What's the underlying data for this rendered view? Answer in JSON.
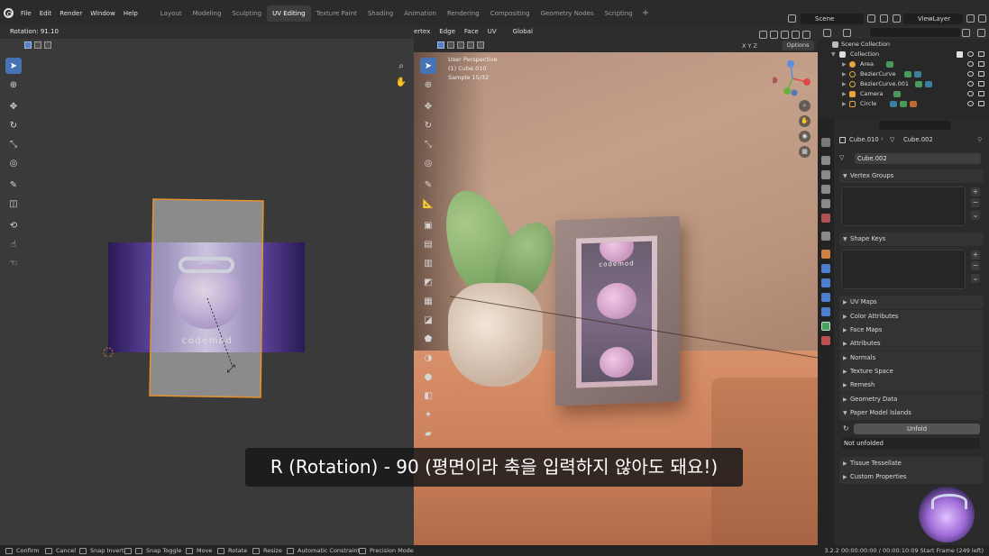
{
  "topbar": {
    "menus": [
      "File",
      "Edit",
      "Render",
      "Window",
      "Help"
    ],
    "workspaces": [
      "Layout",
      "Modeling",
      "Sculpting",
      "UV Editing",
      "Texture Paint",
      "Shading",
      "Animation",
      "Rendering",
      "Compositing",
      "Geometry Nodes",
      "Scripting"
    ],
    "active_workspace": "UV Editing",
    "add_workspace": "+",
    "scene": "Scene",
    "view_layer": "ViewLayer"
  },
  "uv_editor": {
    "rotation_readout": "Rotation: 91.10",
    "logo_text": "codemod"
  },
  "viewport": {
    "menus": [
      "ertex",
      "Edge",
      "Face",
      "UV"
    ],
    "orientation": "Global",
    "options_label": "Options",
    "axes_label": "X Y Z",
    "overlay": {
      "perspective": "User Perspective",
      "object": "(1) Cube.010",
      "samples": "Sample 15/32"
    },
    "frame_logo": "codemod"
  },
  "outliner": {
    "scene_collection": "Scene Collection",
    "collection": "Collection",
    "items": [
      {
        "name": "Area",
        "color": "#e8a33d"
      },
      {
        "name": "BezierCurve",
        "color": "#e8a33d"
      },
      {
        "name": "BezierCurve.001",
        "color": "#e8a33d"
      },
      {
        "name": "Camera",
        "color": "#e8a33d"
      },
      {
        "name": "Circle",
        "color": "#e8a33d"
      }
    ]
  },
  "properties": {
    "breadcrumb_object": "Cube.010",
    "breadcrumb_mesh": "Cube.002",
    "mesh_name": "Cube.002",
    "panels": {
      "vertex_groups": "Vertex Groups",
      "shape_keys": "Shape Keys",
      "uv_maps": "UV Maps",
      "color_attributes": "Color Attributes",
      "face_maps": "Face Maps",
      "attributes": "Attributes",
      "normals": "Normals",
      "texture_space": "Texture Space",
      "remesh": "Remesh",
      "geometry_data": "Geometry Data",
      "paper_model_islands": "Paper Model Islands",
      "tissue_tessellate": "Tissue Tessellate",
      "custom_properties": "Custom Properties"
    },
    "unfold_button": "Unfold",
    "not_unfolded": "Not unfolded"
  },
  "subtitle": "R (Rotation) - 90 (평면이라 축을 입력하지 않아도 돼요!)",
  "statusbar": {
    "hints": [
      "Confirm",
      "Cancel",
      "Snap Invert",
      "Snap Toggle",
      "Move",
      "Rotate",
      "Resize",
      "Automatic Constraint",
      "Precision Mode"
    ],
    "right": "3.2.2  00:00:00:00 / 00:00:10:09  Start Frame (249 left)"
  },
  "colors": {
    "accent": "#4772b3",
    "selection_orange": "#e8912d",
    "header_bg": "#2b2b2b"
  }
}
